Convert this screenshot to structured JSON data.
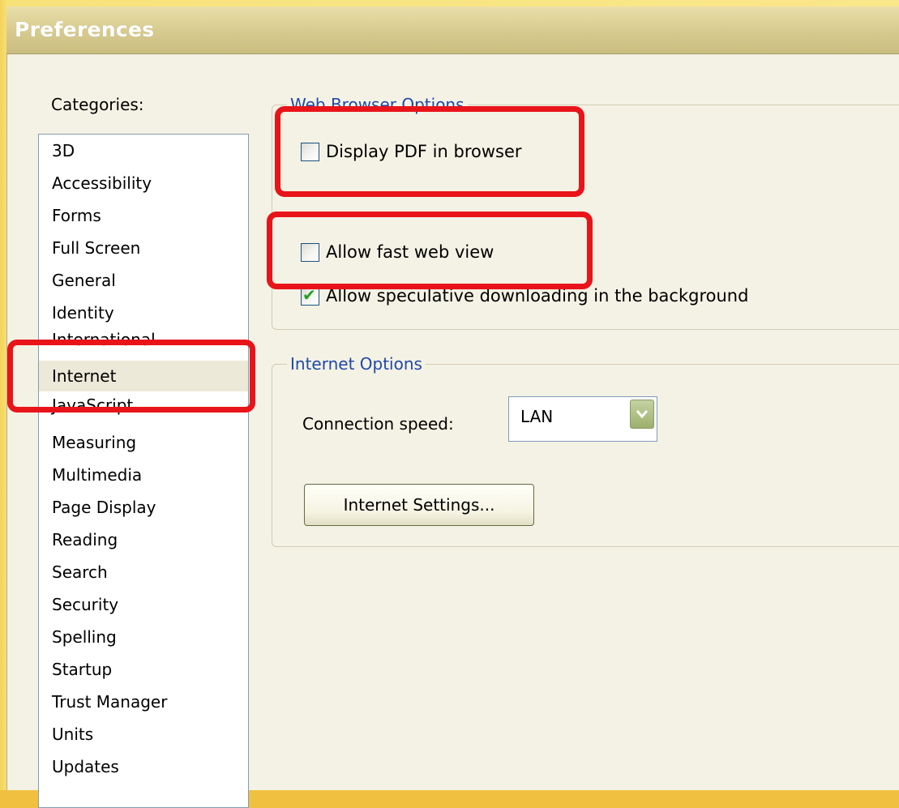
{
  "window": {
    "title": "Preferences"
  },
  "categories": {
    "label": "Categories:",
    "items": [
      {
        "label": "3D"
      },
      {
        "label": "Accessibility"
      },
      {
        "label": "Forms"
      },
      {
        "label": "Full Screen"
      },
      {
        "label": "General"
      },
      {
        "label": "Identity"
      },
      {
        "label": "International"
      },
      {
        "label": "Internet",
        "selected": true
      },
      {
        "label": "JavaScript"
      },
      {
        "label": "Measuring"
      },
      {
        "label": "Multimedia"
      },
      {
        "label": "Page Display"
      },
      {
        "label": "Reading"
      },
      {
        "label": "Search"
      },
      {
        "label": "Security"
      },
      {
        "label": "Spelling"
      },
      {
        "label": "Startup"
      },
      {
        "label": "Trust Manager"
      },
      {
        "label": "Units"
      },
      {
        "label": "Updates"
      }
    ]
  },
  "web_browser_options": {
    "legend": "Web Browser Options",
    "display_pdf": {
      "label": "Display PDF in browser",
      "checked": false
    },
    "fast_web_view": {
      "label": "Allow fast web view",
      "checked": false
    },
    "speculative": {
      "label": "Allow speculative downloading in the background",
      "checked": true
    }
  },
  "internet_options": {
    "legend": "Internet Options",
    "connection_label": "Connection speed:",
    "connection_value": "LAN",
    "settings_button": "Internet Settings..."
  },
  "colors": {
    "callout": "#e8141a",
    "legend_text": "#1f49a8",
    "check_mark": "#21a121"
  }
}
